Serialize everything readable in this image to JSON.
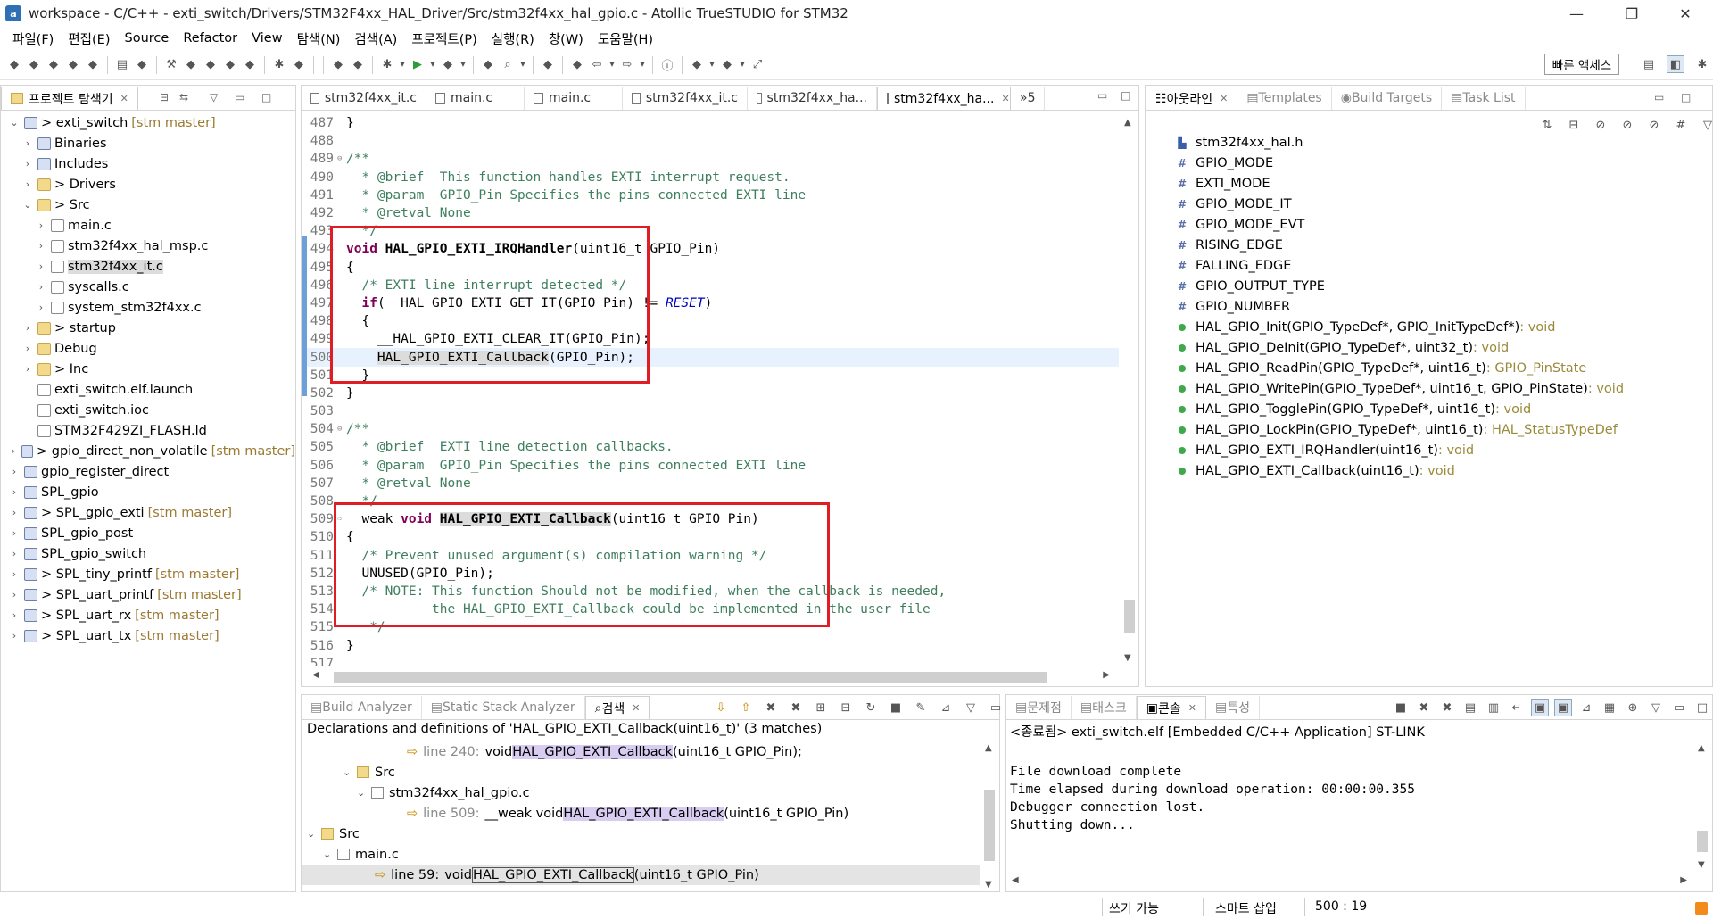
{
  "window": {
    "title": "workspace - C/C++ - exti_switch/Drivers/STM32F4xx_HAL_Driver/Src/stm32f4xx_hal_gpio.c - Atollic TrueSTUDIO for STM32"
  },
  "menu": [
    "파일(F)",
    "편집(E)",
    "Source",
    "Refactor",
    "View",
    "탐색(N)",
    "검색(A)",
    "프로젝트(P)",
    "실행(R)",
    "창(W)",
    "도움말(H)"
  ],
  "quick_access": "빠른 액세스",
  "project_explorer": {
    "title": "프로젝트 탐색기",
    "items": [
      {
        "label": "> exti_switch",
        "git": "[stm master]",
        "indent": 0,
        "arrow": "⌄",
        "icon": "proj"
      },
      {
        "label": "Binaries",
        "git": "",
        "indent": 1,
        "arrow": "›",
        "icon": "bin"
      },
      {
        "label": "Includes",
        "git": "",
        "indent": 1,
        "arrow": "›",
        "icon": "inc"
      },
      {
        "label": "> Drivers",
        "git": "",
        "indent": 1,
        "arrow": "›",
        "icon": "folder"
      },
      {
        "label": "> Src",
        "git": "",
        "indent": 1,
        "arrow": "⌄",
        "icon": "folder"
      },
      {
        "label": "main.c",
        "git": "",
        "indent": 2,
        "arrow": "›",
        "icon": "file"
      },
      {
        "label": "stm32f4xx_hal_msp.c",
        "git": "",
        "indent": 2,
        "arrow": "›",
        "icon": "file"
      },
      {
        "label": "stm32f4xx_it.c",
        "git": "",
        "indent": 2,
        "arrow": "›",
        "icon": "file",
        "selected": true
      },
      {
        "label": "syscalls.c",
        "git": "",
        "indent": 2,
        "arrow": "›",
        "icon": "file"
      },
      {
        "label": "system_stm32f4xx.c",
        "git": "",
        "indent": 2,
        "arrow": "›",
        "icon": "file"
      },
      {
        "label": "> startup",
        "git": "",
        "indent": 1,
        "arrow": "›",
        "icon": "folder"
      },
      {
        "label": "Debug",
        "git": "",
        "indent": 1,
        "arrow": "›",
        "icon": "folder"
      },
      {
        "label": "> Inc",
        "git": "",
        "indent": 1,
        "arrow": "›",
        "icon": "folder"
      },
      {
        "label": "exti_switch.elf.launch",
        "git": "",
        "indent": 1,
        "arrow": "",
        "icon": "file"
      },
      {
        "label": "exti_switch.ioc",
        "git": "",
        "indent": 1,
        "arrow": "",
        "icon": "file"
      },
      {
        "label": "STM32F429ZI_FLASH.ld",
        "git": "",
        "indent": 1,
        "arrow": "",
        "icon": "file"
      },
      {
        "label": "> gpio_direct_non_volatile",
        "git": "[stm master]",
        "indent": 0,
        "arrow": "›",
        "icon": "proj"
      },
      {
        "label": "gpio_register_direct",
        "git": "",
        "indent": 0,
        "arrow": "›",
        "icon": "proj"
      },
      {
        "label": "SPL_gpio",
        "git": "",
        "indent": 0,
        "arrow": "›",
        "icon": "proj"
      },
      {
        "label": "> SPL_gpio_exti",
        "git": "[stm master]",
        "indent": 0,
        "arrow": "›",
        "icon": "proj"
      },
      {
        "label": "SPL_gpio_post",
        "git": "",
        "indent": 0,
        "arrow": "›",
        "icon": "proj"
      },
      {
        "label": "SPL_gpio_switch",
        "git": "",
        "indent": 0,
        "arrow": "›",
        "icon": "proj"
      },
      {
        "label": "> SPL_tiny_printf",
        "git": "[stm master]",
        "indent": 0,
        "arrow": "›",
        "icon": "proj"
      },
      {
        "label": "> SPL_uart_printf",
        "git": "[stm master]",
        "indent": 0,
        "arrow": "›",
        "icon": "proj"
      },
      {
        "label": "> SPL_uart_rx",
        "git": "[stm master]",
        "indent": 0,
        "arrow": "›",
        "icon": "proj"
      },
      {
        "label": "> SPL_uart_tx",
        "git": "[stm master]",
        "indent": 0,
        "arrow": "›",
        "icon": "proj"
      }
    ]
  },
  "editor": {
    "tabs": [
      "stm32f4xx_it.c",
      "main.c",
      "main.c",
      "stm32f4xx_it.c",
      "stm32f4xx_ha...",
      "stm32f4xx_ha..."
    ],
    "overflow": "»5",
    "lines": [
      {
        "n": "487",
        "segs": [
          [
            "",
            "}"
          ]
        ]
      },
      {
        "n": "488",
        "segs": []
      },
      {
        "n": "489",
        "fold": true,
        "segs": [
          [
            "cm",
            "/**"
          ]
        ]
      },
      {
        "n": "490",
        "segs": [
          [
            "cm",
            "  * @brief  This function handles EXTI interrupt request."
          ]
        ]
      },
      {
        "n": "491",
        "segs": [
          [
            "cm",
            "  * @param  GPIO_Pin Specifies the pins connected EXTI line"
          ]
        ]
      },
      {
        "n": "492",
        "segs": [
          [
            "cm",
            "  * @retval None"
          ]
        ]
      },
      {
        "n": "493",
        "segs": [
          [
            "cm",
            "  */"
          ]
        ]
      },
      {
        "n": "494",
        "segs": [
          [
            "kw",
            "void "
          ],
          [
            "b",
            "HAL_GPIO_EXTI_IRQHandler"
          ],
          [
            "",
            "(uint16_t GPIO_Pin)"
          ]
        ]
      },
      {
        "n": "495",
        "segs": [
          [
            "",
            "{"
          ]
        ]
      },
      {
        "n": "496",
        "segs": [
          [
            "cm",
            "  /* EXTI line interrupt detected */"
          ]
        ]
      },
      {
        "n": "497",
        "segs": [
          [
            "",
            "  "
          ],
          [
            "kw",
            "if"
          ],
          [
            "",
            "(__HAL_GPIO_EXTI_GET_IT(GPIO_Pin) != "
          ],
          [
            "it",
            "RESET"
          ],
          [
            "",
            ")"
          ]
        ]
      },
      {
        "n": "498",
        "segs": [
          [
            "",
            "  {"
          ]
        ]
      },
      {
        "n": "499",
        "segs": [
          [
            "",
            "    __HAL_GPIO_EXTI_CLEAR_IT(GPIO_Pin);"
          ]
        ]
      },
      {
        "n": "500",
        "cur": true,
        "segs": [
          [
            "",
            "    "
          ],
          [
            "hl",
            "HAL_GPIO_EXTI_Callback"
          ],
          [
            "",
            "(GPIO_Pin);"
          ]
        ]
      },
      {
        "n": "501",
        "segs": [
          [
            "",
            "  }"
          ]
        ]
      },
      {
        "n": "502",
        "segs": [
          [
            "",
            "}"
          ]
        ]
      },
      {
        "n": "503",
        "segs": []
      },
      {
        "n": "504",
        "fold": true,
        "segs": [
          [
            "cm",
            "/**"
          ]
        ]
      },
      {
        "n": "505",
        "segs": [
          [
            "cm",
            "  * @brief  EXTI line detection callbacks."
          ]
        ]
      },
      {
        "n": "506",
        "segs": [
          [
            "cm",
            "  * @param  GPIO_Pin Specifies the pins connected EXTI line"
          ]
        ]
      },
      {
        "n": "507",
        "segs": [
          [
            "cm",
            "  * @retval None"
          ]
        ]
      },
      {
        "n": "508",
        "segs": [
          [
            "cm",
            "  */"
          ]
        ]
      },
      {
        "n": "509",
        "arrow": true,
        "segs": [
          [
            "",
            "__weak "
          ],
          [
            "kw",
            "void "
          ],
          [
            "hlb",
            "HAL_GPIO_EXTI_Callback"
          ],
          [
            "",
            "(uint16_t GPIO_Pin)"
          ]
        ]
      },
      {
        "n": "510",
        "segs": [
          [
            "",
            "{"
          ]
        ]
      },
      {
        "n": "511",
        "segs": [
          [
            "cm",
            "  /* Prevent unused argument(s) compilation warning */"
          ]
        ]
      },
      {
        "n": "512",
        "segs": [
          [
            "",
            "  UNUSED(GPIO_Pin);"
          ]
        ]
      },
      {
        "n": "513",
        "segs": [
          [
            "cm",
            "  /* NOTE: This function Should not be modified, when the callback is needed,"
          ]
        ]
      },
      {
        "n": "514",
        "segs": [
          [
            "cm",
            "           the HAL_GPIO_EXTI_Callback could be implemented in the user file"
          ]
        ]
      },
      {
        "n": "515",
        "segs": [
          [
            "cm",
            "   */"
          ]
        ]
      },
      {
        "n": "516",
        "segs": [
          [
            "",
            "}"
          ]
        ]
      },
      {
        "n": "517",
        "segs": []
      }
    ]
  },
  "outline": {
    "tabs": [
      "아웃라인",
      "Templates",
      "Build Targets",
      "Task List"
    ],
    "items": [
      {
        "kind": "include",
        "label": "stm32f4xx_hal.h",
        "type": ""
      },
      {
        "kind": "macro",
        "label": "GPIO_MODE",
        "type": ""
      },
      {
        "kind": "macro",
        "label": "EXTI_MODE",
        "type": ""
      },
      {
        "kind": "macro",
        "label": "GPIO_MODE_IT",
        "type": ""
      },
      {
        "kind": "macro",
        "label": "GPIO_MODE_EVT",
        "type": ""
      },
      {
        "kind": "macro",
        "label": "RISING_EDGE",
        "type": ""
      },
      {
        "kind": "macro",
        "label": "FALLING_EDGE",
        "type": ""
      },
      {
        "kind": "macro",
        "label": "GPIO_OUTPUT_TYPE",
        "type": ""
      },
      {
        "kind": "macro",
        "label": "GPIO_NUMBER",
        "type": ""
      },
      {
        "kind": "func",
        "label": "HAL_GPIO_Init(GPIO_TypeDef*, GPIO_InitTypeDef*)",
        "type": " : void"
      },
      {
        "kind": "func",
        "label": "HAL_GPIO_DeInit(GPIO_TypeDef*, uint32_t)",
        "type": " : void"
      },
      {
        "kind": "func",
        "label": "HAL_GPIO_ReadPin(GPIO_TypeDef*, uint16_t)",
        "type": " : GPIO_PinState"
      },
      {
        "kind": "func",
        "label": "HAL_GPIO_WritePin(GPIO_TypeDef*, uint16_t, GPIO_PinState)",
        "type": " : void"
      },
      {
        "kind": "func",
        "label": "HAL_GPIO_TogglePin(GPIO_TypeDef*, uint16_t)",
        "type": " : void"
      },
      {
        "kind": "func",
        "label": "HAL_GPIO_LockPin(GPIO_TypeDef*, uint16_t)",
        "type": " : HAL_StatusTypeDef"
      },
      {
        "kind": "func",
        "label": "HAL_GPIO_EXTI_IRQHandler(uint16_t)",
        "type": " : void"
      },
      {
        "kind": "func",
        "label": "HAL_GPIO_EXTI_Callback(uint16_t)",
        "type": " : void"
      }
    ]
  },
  "search": {
    "tabs": [
      "Build Analyzer",
      "Static Stack Analyzer",
      "검색"
    ],
    "header": "Declarations and definitions of 'HAL_GPIO_EXTI_Callback(uint16_t)' (3 matches)",
    "rows": [
      {
        "kind": "match",
        "lineno": "line 240:",
        "pre": "void ",
        "mark": "HAL_GPIO_EXTI_Callback",
        "post": "(uint16_t GPIO_Pin);"
      },
      {
        "kind": "folder",
        "label": "Src"
      },
      {
        "kind": "file",
        "label": "stm32f4xx_hal_gpio.c"
      },
      {
        "kind": "match",
        "lineno": "line 509:",
        "pre": "__weak void ",
        "mark": "HAL_GPIO_EXTI_Callback",
        "post": "(uint16_t GPIO_Pin)"
      },
      {
        "kind": "folder",
        "label": "Src"
      },
      {
        "kind": "file",
        "label": "main.c"
      },
      {
        "kind": "match",
        "lineno": "line 59:",
        "pre": "void ",
        "mark": "HAL_GPIO_EXTI_Callback",
        "post": "(uint16_t GPIO_Pin)"
      }
    ]
  },
  "console": {
    "tabs": [
      "문제점",
      "태스크",
      "콘솔",
      "특성"
    ],
    "header": "<종료됨> exti_switch.elf [Embedded C/C++ Application] ST-LINK",
    "lines": [
      "File download complete",
      "Time elapsed during download operation: 00:00:00.355",
      "Debugger connection lost.",
      "Shutting down..."
    ]
  },
  "status": {
    "writable": "쓰기 가능",
    "insert_mode": "스마트 삽입",
    "position": "500 : 19"
  }
}
